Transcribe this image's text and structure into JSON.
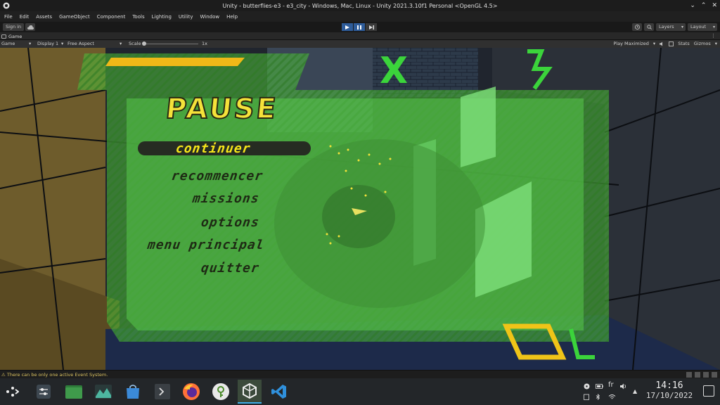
{
  "window": {
    "title": "Unity - butterflies-e3 - e3_city - Windows, Mac, Linux - Unity 2021.3.10f1 Personal <OpenGL 4.5>"
  },
  "menu": [
    "File",
    "Edit",
    "Assets",
    "GameObject",
    "Component",
    "Tools",
    "Lighting",
    "Utility",
    "Window",
    "Help"
  ],
  "toolbar": {
    "sign_in": "Sign in",
    "layers": "Layers",
    "layout": "Layout"
  },
  "game_tab": {
    "label": "Game"
  },
  "game_bar": {
    "view": "Game",
    "display": "Display 1",
    "aspect": "Free Aspect",
    "scale_label": "Scale",
    "scale_value": "1x",
    "play_mode": "Play Maximized",
    "stats": "Stats",
    "gizmos": "Gizmos"
  },
  "pause_menu": {
    "title": "PAUSE",
    "items": [
      "continuer",
      "recommencer",
      "missions",
      "options",
      "menu principal",
      "quitter"
    ],
    "selected_index": 0
  },
  "status": {
    "message": "There can be only one active Event System."
  },
  "taskbar": {
    "apps": [
      "launcher-icon",
      "settings-icon",
      "file-manager-icon",
      "system-monitor-icon",
      "discover-store-icon",
      "terminal-icon",
      "firefox-icon",
      "keepass-icon",
      "unity-icon",
      "vscode-icon"
    ],
    "active_app": "unity-icon",
    "language": "fr",
    "time": "14:16",
    "date": "17/10/2022"
  },
  "colors": {
    "menu_green": "#4fbf3a",
    "title_yellow": "#f5e23a",
    "accent_blue": "#3daee9",
    "editor_bg": "#1e1e1e"
  }
}
